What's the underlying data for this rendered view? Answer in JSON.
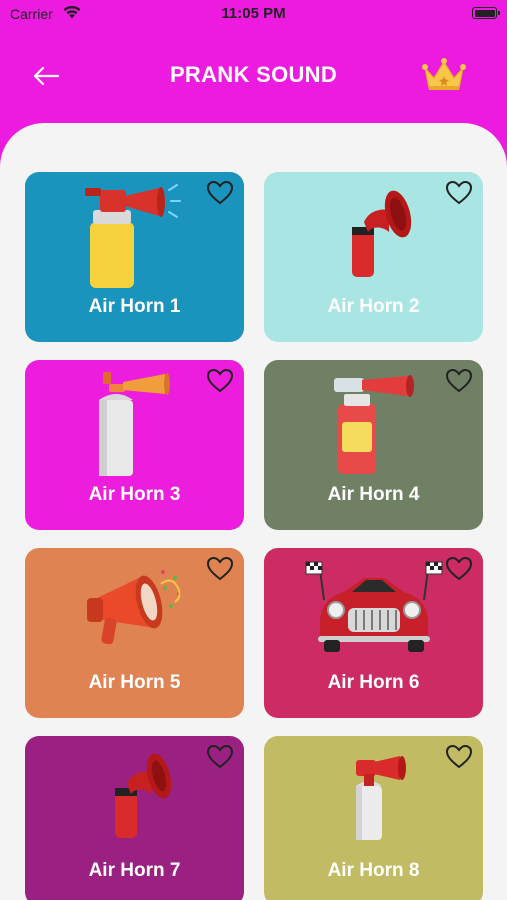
{
  "status_bar": {
    "carrier": "Carrier",
    "time": "11:05 PM"
  },
  "header": {
    "title": "PRANK SOUND",
    "back_icon": "arrow-left-icon",
    "premium_icon": "crown-icon"
  },
  "colors": {
    "header_bg": "#ed1be0",
    "content_bg": "#f4f4f4"
  },
  "sounds": [
    {
      "label": "Air Horn 1",
      "bg": "#1a93bd",
      "favorite": false
    },
    {
      "label": "Air Horn 2",
      "bg": "#a8e5e3",
      "favorite": false
    },
    {
      "label": "Air Horn 3",
      "bg": "#ec1ddc",
      "favorite": false
    },
    {
      "label": "Air Horn 4",
      "bg": "#708064",
      "favorite": false
    },
    {
      "label": "Air Horn 5",
      "bg": "#df8352",
      "favorite": false
    },
    {
      "label": "Air Horn 6",
      "bg": "#cc2b63",
      "favorite": false
    },
    {
      "label": "Air Horn 7",
      "bg": "#9a2182",
      "favorite": false
    },
    {
      "label": "Air Horn 8",
      "bg": "#c1bc63",
      "favorite": false
    }
  ]
}
